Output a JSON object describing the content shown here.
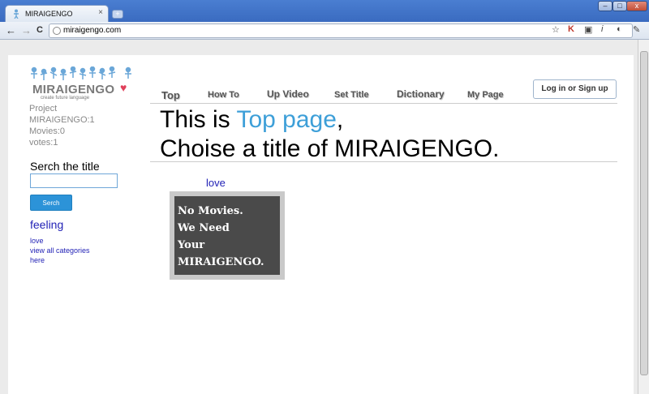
{
  "browser": {
    "tab_title": "MIRAIGENGO",
    "tab_close": "×",
    "new_tab": "+",
    "url": "miraigengo.com",
    "back": "←",
    "forward": "→",
    "reload": "C",
    "window": {
      "minimize": "–",
      "maximize": "□",
      "close": "x"
    }
  },
  "site": {
    "logo": {
      "name": "MIRAIGENGO",
      "tagline": "create future language"
    },
    "nav": [
      "Top",
      "How To",
      "Up Video",
      "Set Title",
      "Dictionary",
      "My Page"
    ],
    "login": "Log in or Sign up"
  },
  "sidebar": {
    "stats": [
      "Project",
      "MIRAIGENGO:1",
      "Movies:0",
      "votes:1"
    ],
    "search_title": "Serch the title",
    "search_value": "",
    "search_button": "Serch",
    "category_title": "feeling",
    "links": [
      "love",
      "view all categories",
      "here"
    ]
  },
  "main": {
    "headline_prefix": "This is ",
    "headline_accent": "Top page",
    "headline_suffix": ",",
    "headline_line2": "Choise a title of MIRAIGENGO.",
    "movie_label": "love",
    "movie_placeholder": [
      "No Movies.",
      "We Need",
      "Your",
      "MIRAIGENGO."
    ]
  },
  "colors": {
    "accent": "#3d9fd8",
    "link": "#1f1fb5",
    "button": "#2c93d8"
  }
}
